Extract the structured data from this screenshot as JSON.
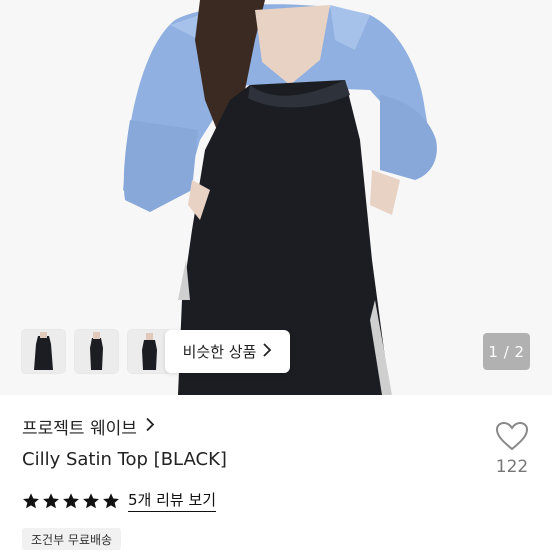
{
  "gallery": {
    "counter_text": "1 / 2",
    "similar_label": "비슷한 상품",
    "thumbnails": [
      "thumb-1",
      "thumb-2",
      "thumb-3"
    ]
  },
  "product": {
    "brand": "프로젝트 웨이브",
    "title": "Cilly Satin Top [BLACK]",
    "like_count": "122",
    "rating_stars": 5,
    "review_link": "5개 리뷰 보기",
    "shipping_badge": "조건부 무료배송"
  },
  "icons": {
    "brand_chevron": "chevron-right-icon",
    "similar_chevron": "chevron-right-icon",
    "like": "heart-outline-icon",
    "star": "star-filled-icon"
  },
  "colors": {
    "shirt_blue": "#8fb0e0",
    "top_black": "#1b1d22",
    "text": "#222222",
    "muted": "#777777"
  }
}
